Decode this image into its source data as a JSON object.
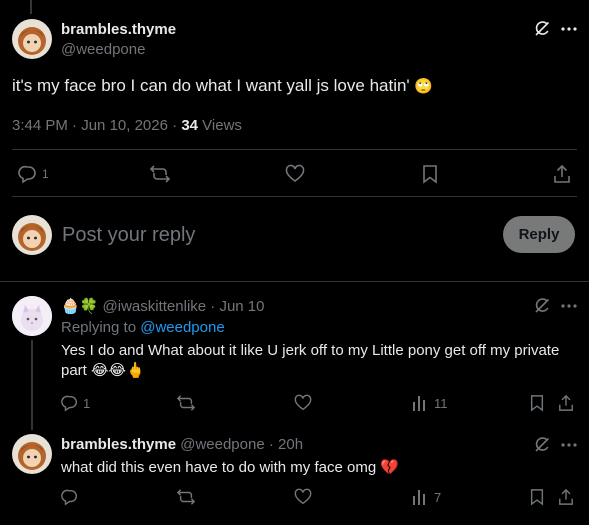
{
  "main_post": {
    "display_name": "brambles.thyme",
    "handle": "@weedpone",
    "text": "it's my face bro I can do what I want yall js love hatin'",
    "emoji": "🙄",
    "time": "3:44 PM",
    "date": "Jun 10, 2026",
    "separator": "·",
    "views_count": "34",
    "views_label": "Views",
    "reply_count": "1"
  },
  "composer": {
    "placeholder": "Post your reply",
    "button_label": "Reply"
  },
  "replies": [
    {
      "name_emojis": "🧁🍀",
      "handle": "@iwaskittenlike",
      "time": "· Jun 10",
      "replying_prefix": "Replying to",
      "replying_handle": "@weedpone",
      "text": "Yes I do and What about it like U jerk off to my Little pony get off my private part",
      "emojis": "😂😂🖕",
      "reply_count": "1",
      "views": "11"
    },
    {
      "display_name": "brambles.thyme",
      "handle": "@weedpone",
      "time": "· 20h",
      "text": "what did this even have to do with my face omg",
      "emoji": "💔",
      "views": "7"
    }
  ],
  "icons": [
    "grok-icon",
    "more-icon",
    "reply-icon",
    "repost-icon",
    "like-icon",
    "bookmark-icon",
    "share-icon",
    "views-icon"
  ]
}
